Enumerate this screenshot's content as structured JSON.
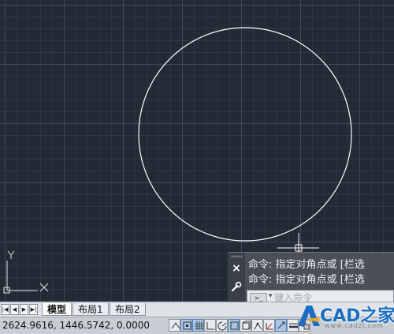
{
  "ucs": {
    "y_label": "Y",
    "x_label": "X"
  },
  "command_window": {
    "history": [
      "命令: 指定对角点或 [栏选",
      "命令: 指定对角点或 [栏选"
    ],
    "input_placeholder": "键入命令",
    "prompt_icon": ">_",
    "close_icon": "×"
  },
  "layout_tabs": {
    "nav_buttons": [
      "|◀",
      "◀",
      "▶",
      "▶|"
    ],
    "tabs": [
      {
        "label": "模型",
        "active": true
      },
      {
        "label": "布局1",
        "active": false
      },
      {
        "label": "布局2",
        "active": false
      }
    ]
  },
  "status_bar": {
    "coordinates": "2624.9616, 1446.5742, 0.0000",
    "toggles": [
      {
        "name": "infer-constraints",
        "on": false
      },
      {
        "name": "snap-mode",
        "on": true
      },
      {
        "name": "grid-display",
        "on": true
      },
      {
        "name": "ortho-mode",
        "on": false
      },
      {
        "name": "polar-tracking",
        "on": false
      },
      {
        "name": "object-snap",
        "on": true
      },
      {
        "name": "3d-object-snap",
        "on": false
      },
      {
        "name": "object-snap-tracking",
        "on": false
      },
      {
        "name": "dynamic-ucs",
        "on": false
      },
      {
        "name": "dynamic-input",
        "on": true
      },
      {
        "name": "lineweight",
        "on": false
      },
      {
        "name": "transparency",
        "on": false
      }
    ]
  },
  "watermark": {
    "text": "CAD之家",
    "sub": "www.cadzj.com"
  },
  "colors": {
    "canvas": "#222a35",
    "circle": "#ffffff",
    "accent": "#1a6fc2"
  }
}
